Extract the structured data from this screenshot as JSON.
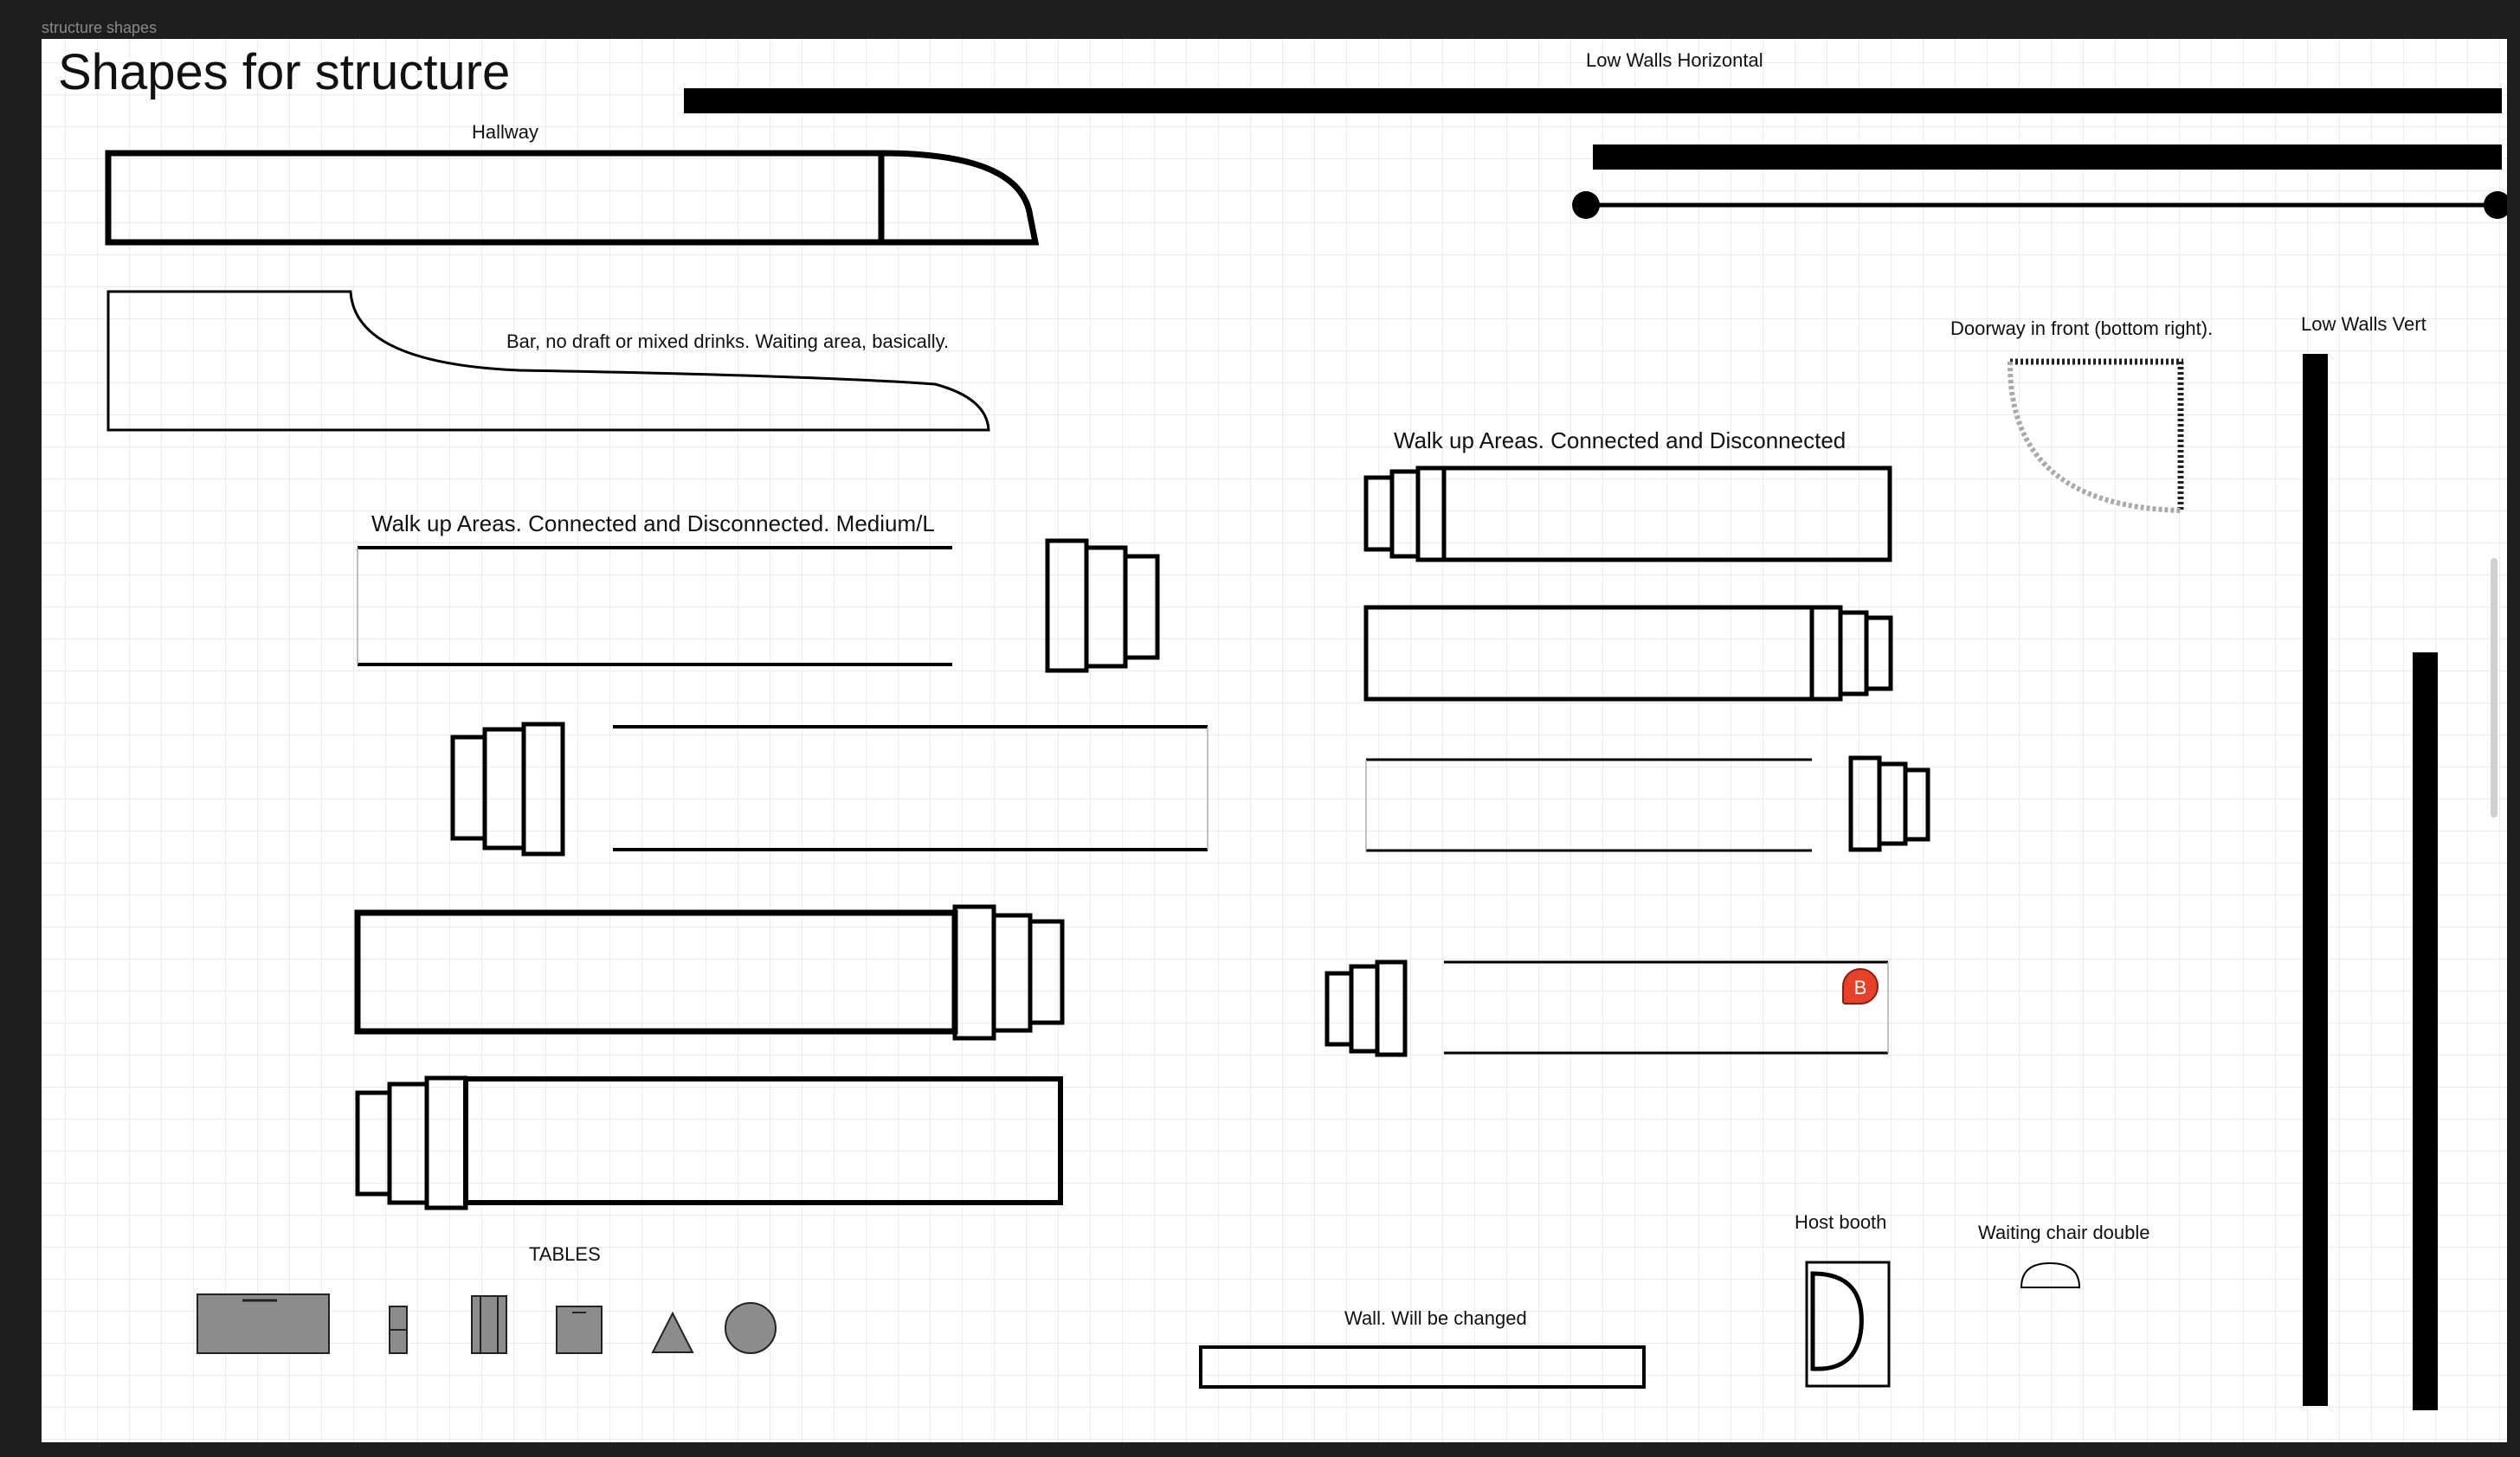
{
  "frame": {
    "name": "structure shapes"
  },
  "title": "Shapes for structure",
  "labels": {
    "low_walls_horizontal": "Low Walls Horizontal",
    "hallway": "Hallway",
    "bar": "Bar, no draft or mixed drinks. Waiting area, basically.",
    "doorway": "Doorway in front (bottom right).",
    "low_walls_vert": "Low Walls Vert",
    "walk_up_right": "Walk up Areas. Connected and Disconnected",
    "walk_up_left": "Walk up Areas. Connected and Disconnected. Medium/L",
    "tables": "TABLES",
    "wall_changed": "Wall. Will be changed",
    "host_booth": "Host booth",
    "waiting_chair": "Waiting chair double"
  },
  "cursor": {
    "initial": "B",
    "color": "#e8412a"
  },
  "colors": {
    "canvas": "#ffffff",
    "chrome": "#1e1e1e",
    "stroke": "#111111",
    "table_fill": "#8c8c8c"
  },
  "icons": {
    "cursor": "collaborator-cursor-icon"
  }
}
